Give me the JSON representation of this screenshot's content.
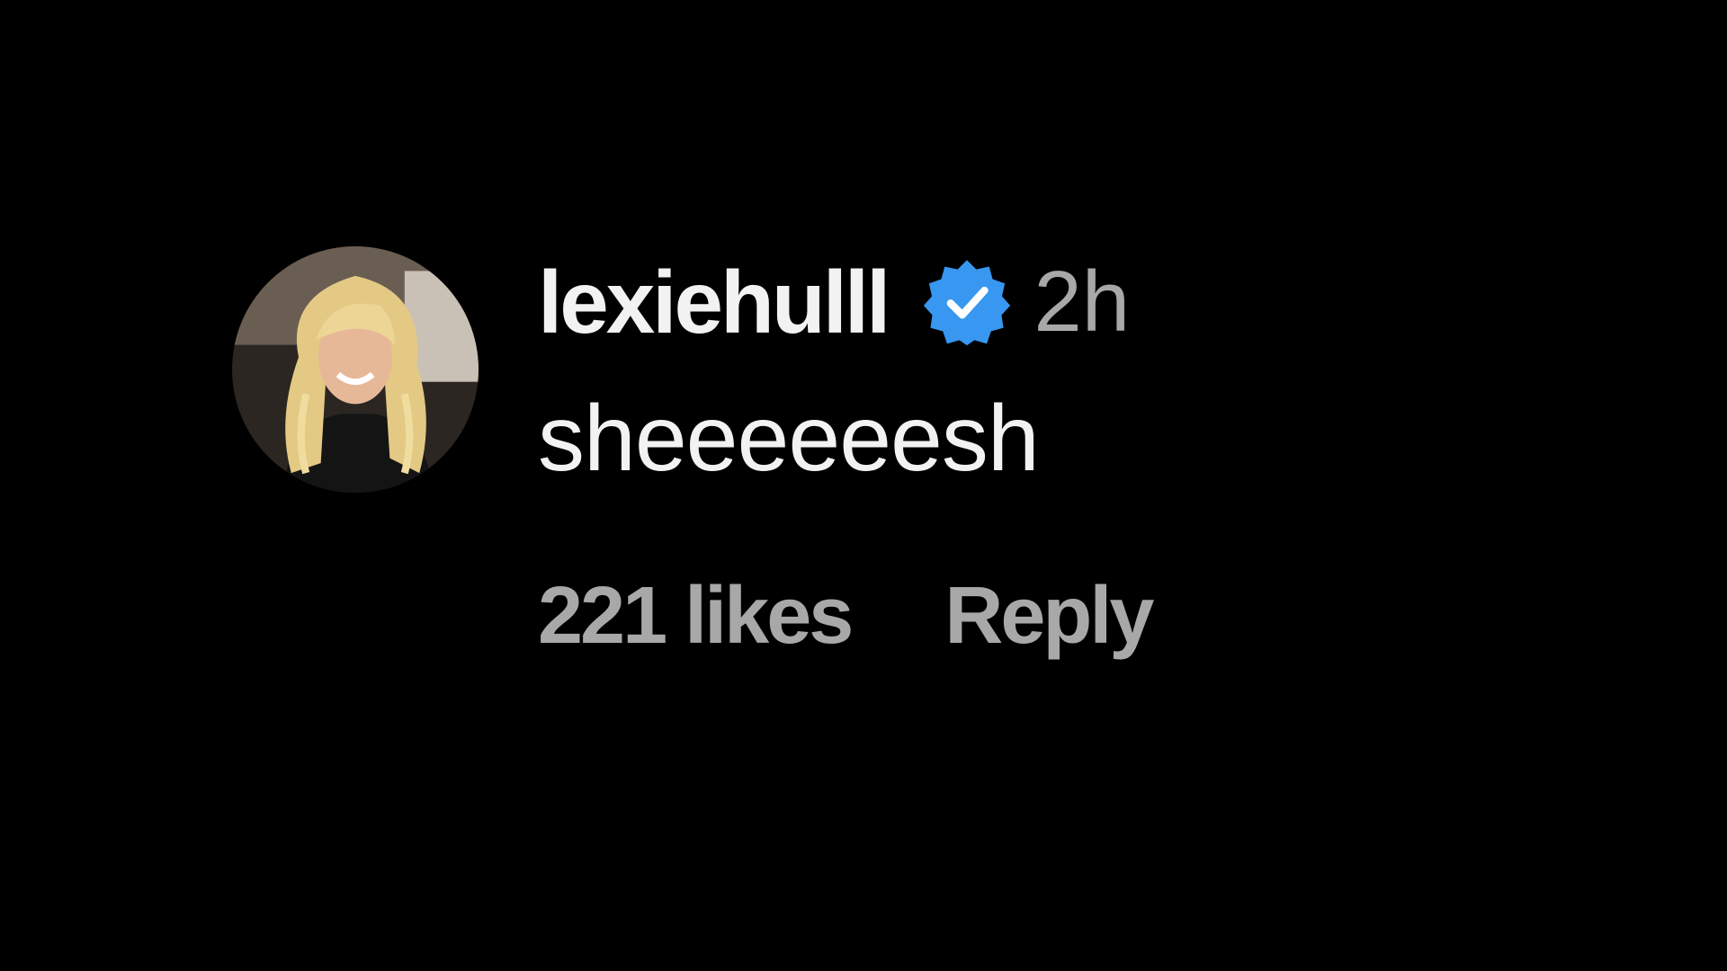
{
  "comment": {
    "username": "lexiehulll",
    "verified_icon": "verified-badge-icon",
    "timestamp": "2h",
    "text": "sheeeeeesh",
    "likes_label": "221 likes",
    "reply_label": "Reply"
  },
  "colors": {
    "background": "#000000",
    "primary_text": "#f2f2f2",
    "secondary_text": "#a8a8a8",
    "verified_blue": "#3897f0"
  }
}
